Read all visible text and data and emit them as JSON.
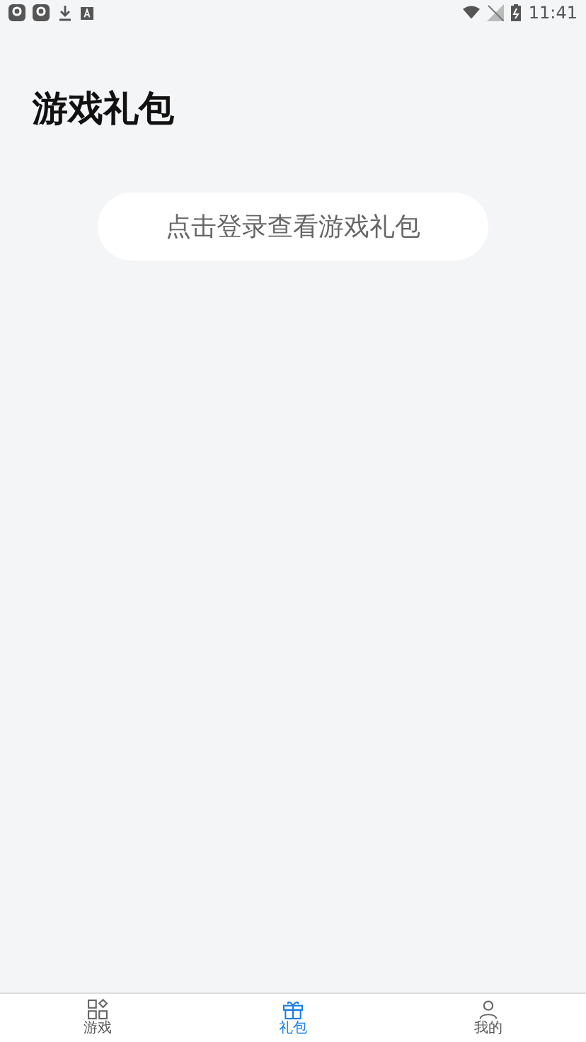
{
  "status_bar": {
    "time": "11:41"
  },
  "header": {
    "title": "游戏礼包"
  },
  "login_prompt": {
    "label": "点击登录查看游戏礼包"
  },
  "tab_bar": [
    {
      "label": "游戏",
      "kind": "games",
      "selected": false
    },
    {
      "label": "礼包",
      "kind": "gift",
      "selected": true
    },
    {
      "label": "我的",
      "kind": "profile",
      "selected": false
    }
  ]
}
